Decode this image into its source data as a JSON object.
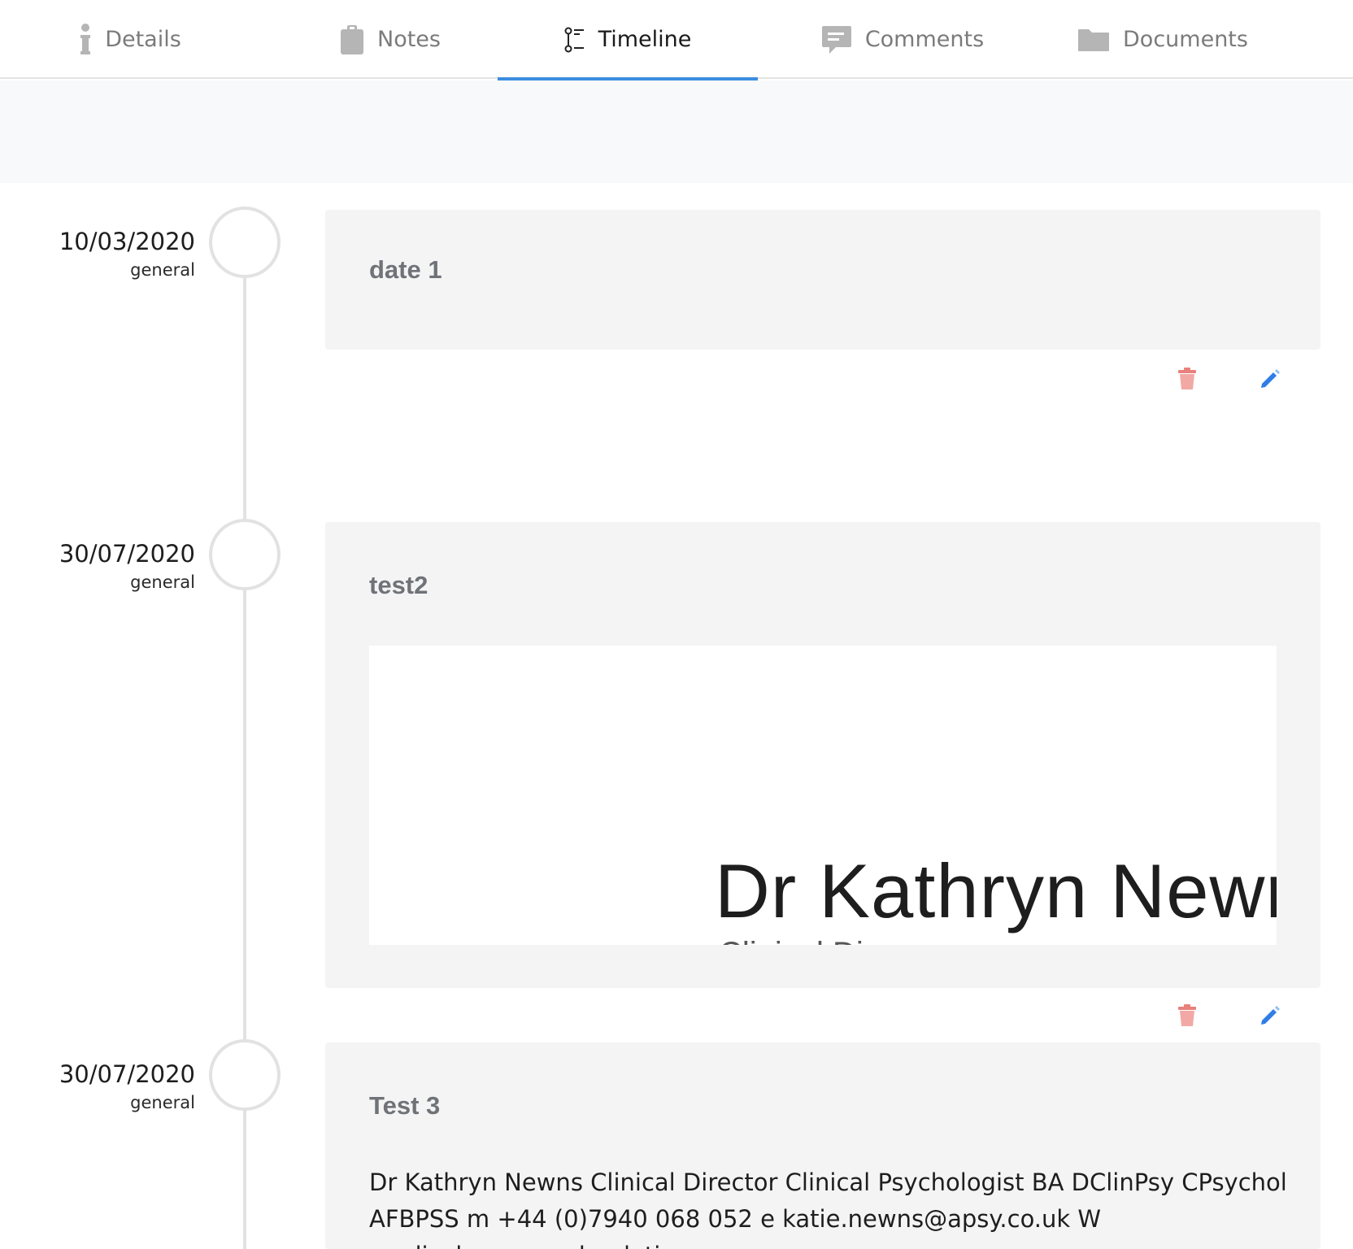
{
  "tabs": [
    {
      "label": "Details",
      "icon": "info-icon"
    },
    {
      "label": "Notes",
      "icon": "clipboard-icon"
    },
    {
      "label": "Timeline",
      "icon": "timeline-icon",
      "active": true
    },
    {
      "label": "Comments",
      "icon": "comment-icon"
    },
    {
      "label": "Documents",
      "icon": "folder-icon"
    }
  ],
  "timeline": {
    "entries": [
      {
        "date": "10/03/2020",
        "category": "general",
        "title": "date 1"
      },
      {
        "date": "30/07/2020",
        "category": "general",
        "title": "test2",
        "image_text": "Dr Kathryn Newr",
        "image_subtext": "Clinical Di"
      },
      {
        "date": "30/07/2020",
        "category": "general",
        "title": "Test 3",
        "body": "Dr Kathryn Newns Clinical Director Clinical Psychologist BA DClinPsy CPsychol AFBPSS m +44 (0)7940 068 052 e katie.newns@apsy.co.uk W medical.apsy.co.uk relation"
      }
    ]
  },
  "colors": {
    "accent": "#3c8de0",
    "delete": "#e8817d",
    "edit": "#2f7ee6",
    "card_bg": "#f4f4f4",
    "band_bg": "#f8f9fa"
  }
}
